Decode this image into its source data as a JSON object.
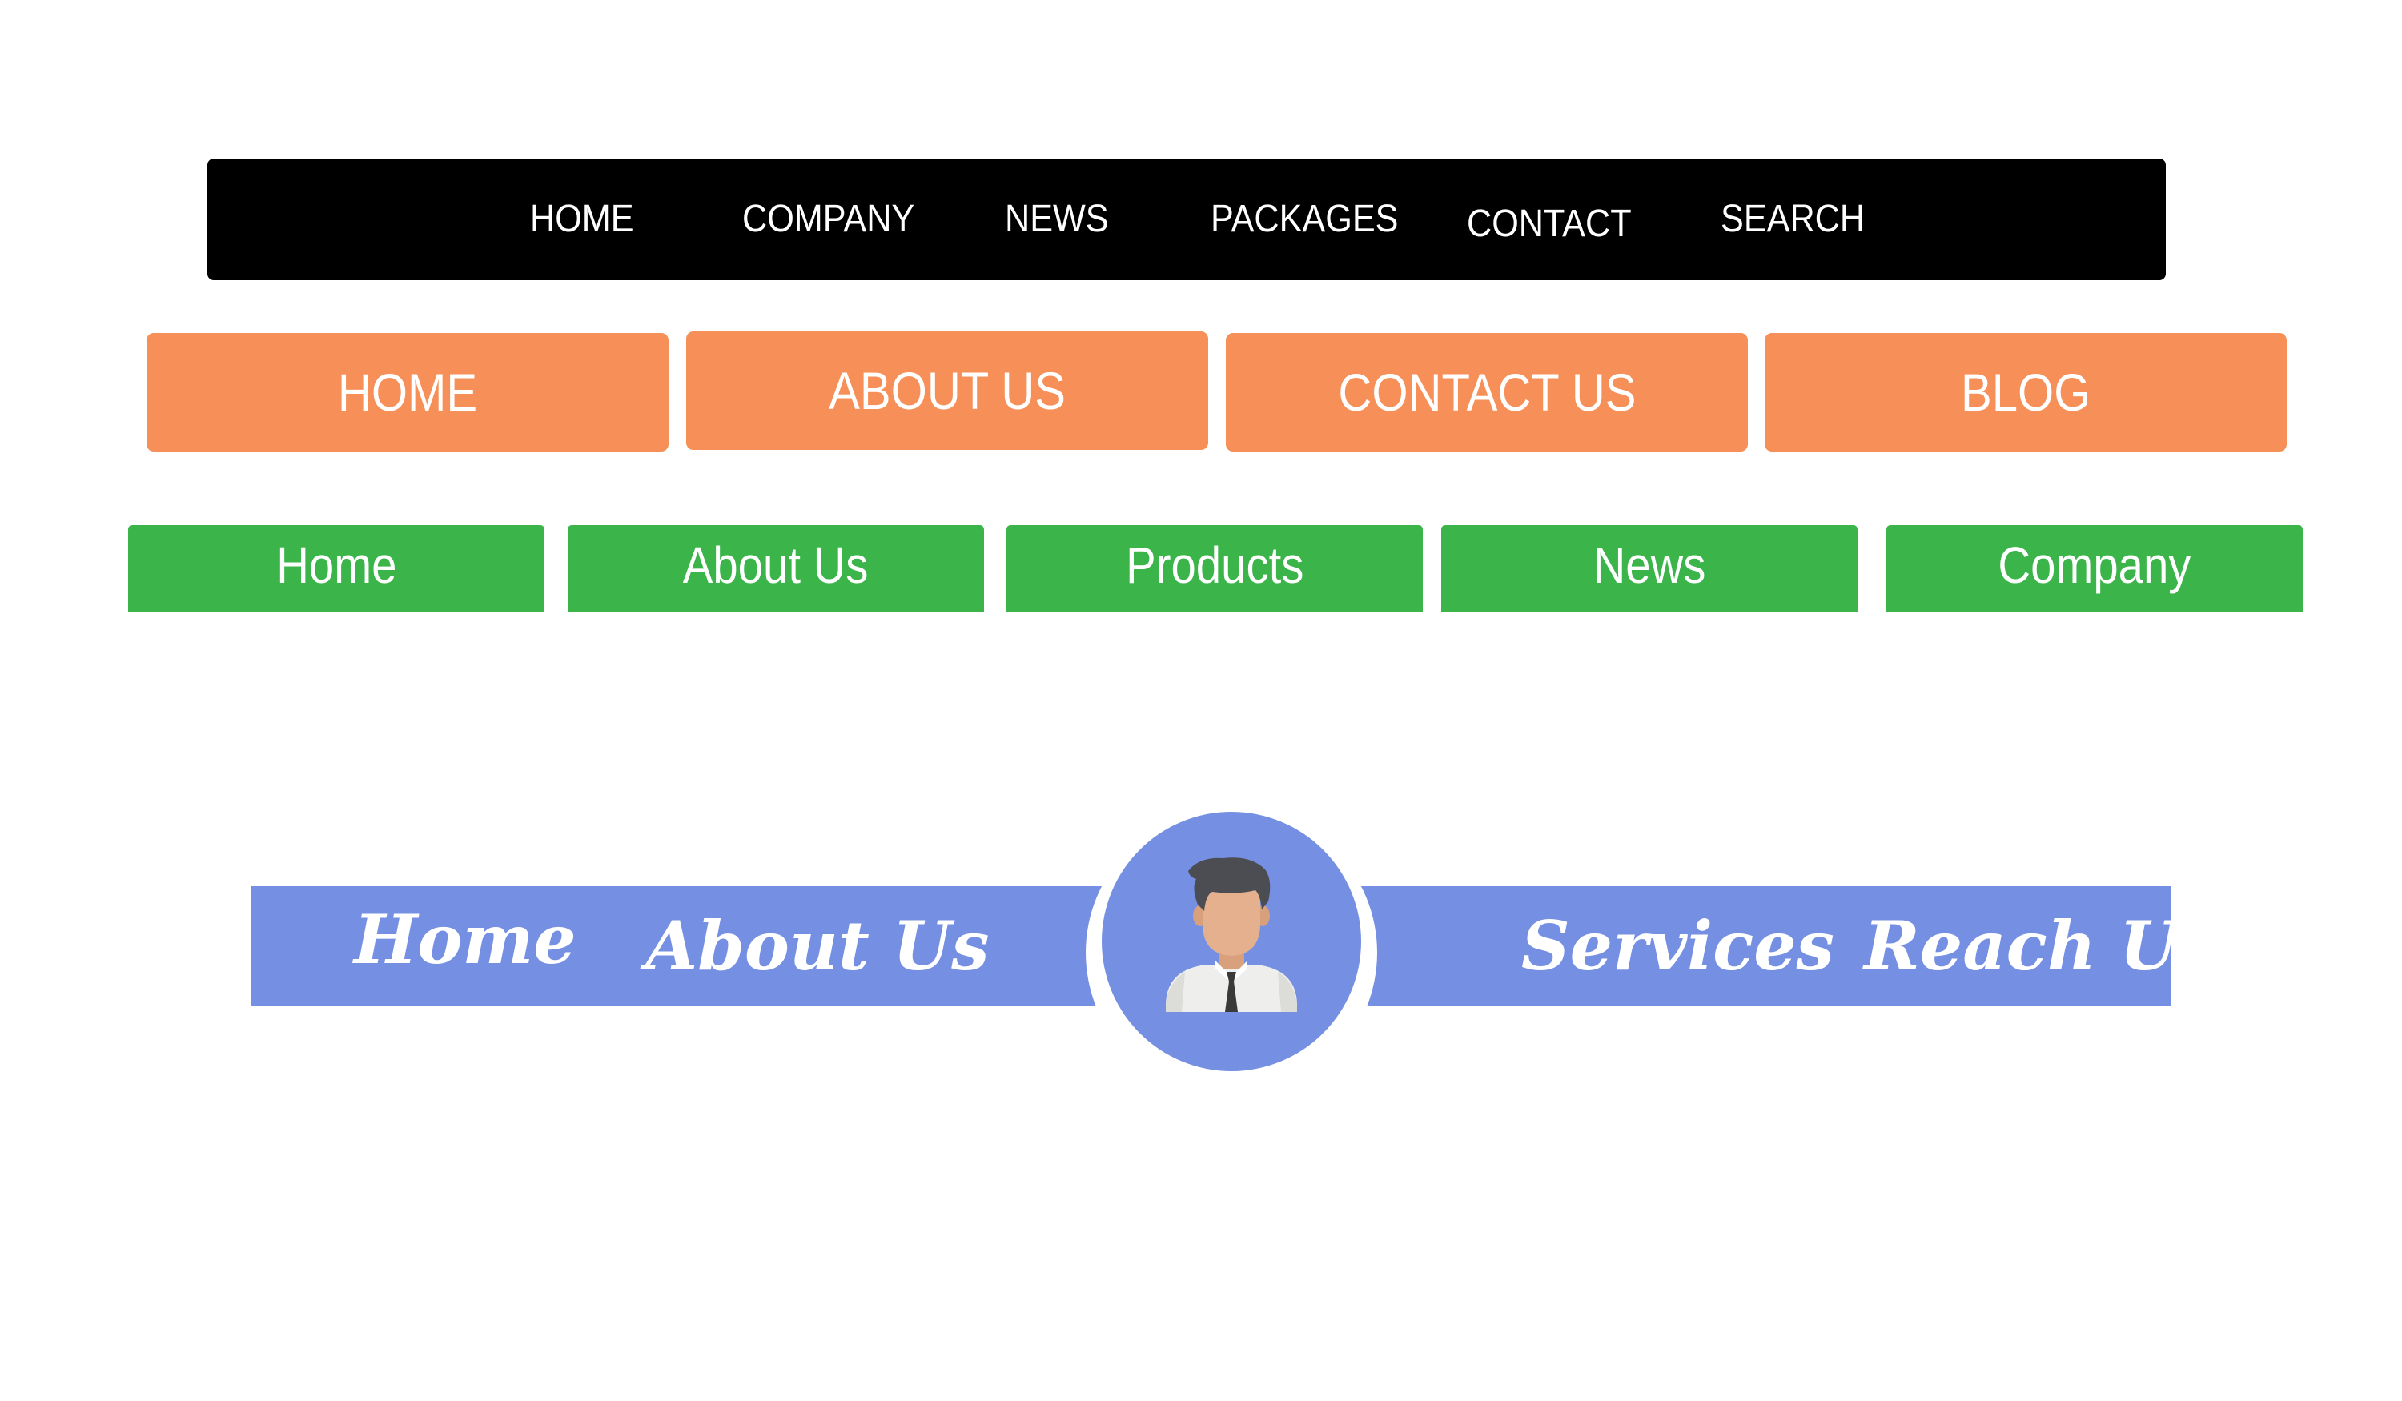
{
  "black_nav": {
    "items": [
      "HOME",
      "COMPANY",
      "NEWS",
      "PACKAGES",
      "CONTACT",
      "SEARCH"
    ]
  },
  "orange_nav": {
    "items": [
      "HOME",
      "ABOUT US",
      "CONTACT US",
      "BLOG"
    ]
  },
  "green_nav": {
    "items": [
      "Home",
      "About Us",
      "Products",
      "News",
      "Company"
    ]
  },
  "blue_nav": {
    "left_items": [
      "Home",
      "About Us"
    ],
    "right_items": [
      "Services",
      "Reach Us"
    ],
    "avatar_icon": "user-avatar-icon"
  },
  "colors": {
    "black_nav_bg": "#000000",
    "orange_button": "#f69058",
    "green_tab": "#3bb54a",
    "blue_bar": "#7590e2"
  }
}
